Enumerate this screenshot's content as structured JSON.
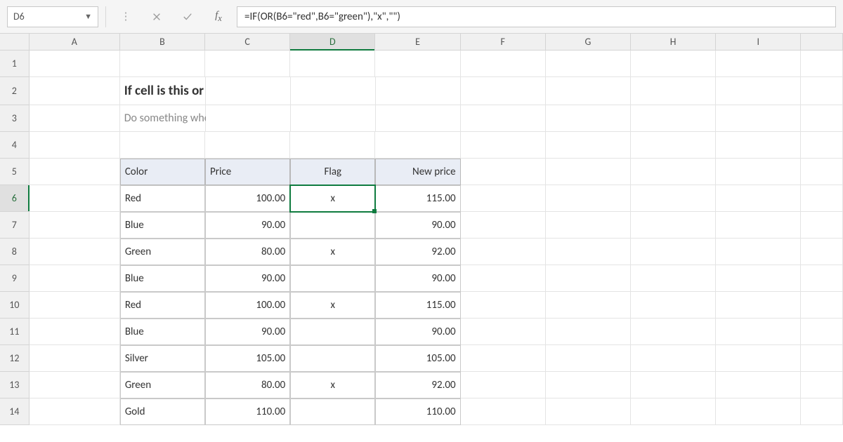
{
  "formula_bar": {
    "cell_ref": "D6",
    "formula": "=IF(OR(B6=\"red\",B6=\"green\"),\"x\",\"\")"
  },
  "columns": [
    "A",
    "B",
    "C",
    "D",
    "E",
    "F",
    "G",
    "H",
    "I"
  ],
  "rows": [
    "1",
    "2",
    "3",
    "4",
    "5",
    "6",
    "7",
    "8",
    "9",
    "10",
    "11",
    "12",
    "13",
    "14"
  ],
  "title": "If cell is this or that",
  "subtitle": "Do something when a cell contains X or Y",
  "selected": {
    "col": "D",
    "row": "6"
  },
  "table": {
    "headers": {
      "color": "Color",
      "price": "Price",
      "flag": "Flag",
      "newprice": "New price"
    },
    "rows": [
      {
        "color": "Red",
        "price": "100.00",
        "flag": "x",
        "newprice": "115.00"
      },
      {
        "color": "Blue",
        "price": "90.00",
        "flag": "",
        "newprice": "90.00"
      },
      {
        "color": "Green",
        "price": "80.00",
        "flag": "x",
        "newprice": "92.00"
      },
      {
        "color": "Blue",
        "price": "90.00",
        "flag": "",
        "newprice": "90.00"
      },
      {
        "color": "Red",
        "price": "100.00",
        "flag": "x",
        "newprice": "115.00"
      },
      {
        "color": "Blue",
        "price": "90.00",
        "flag": "",
        "newprice": "90.00"
      },
      {
        "color": "Silver",
        "price": "105.00",
        "flag": "",
        "newprice": "105.00"
      },
      {
        "color": "Green",
        "price": "80.00",
        "flag": "x",
        "newprice": "92.00"
      },
      {
        "color": "Gold",
        "price": "110.00",
        "flag": "",
        "newprice": "110.00"
      }
    ]
  }
}
